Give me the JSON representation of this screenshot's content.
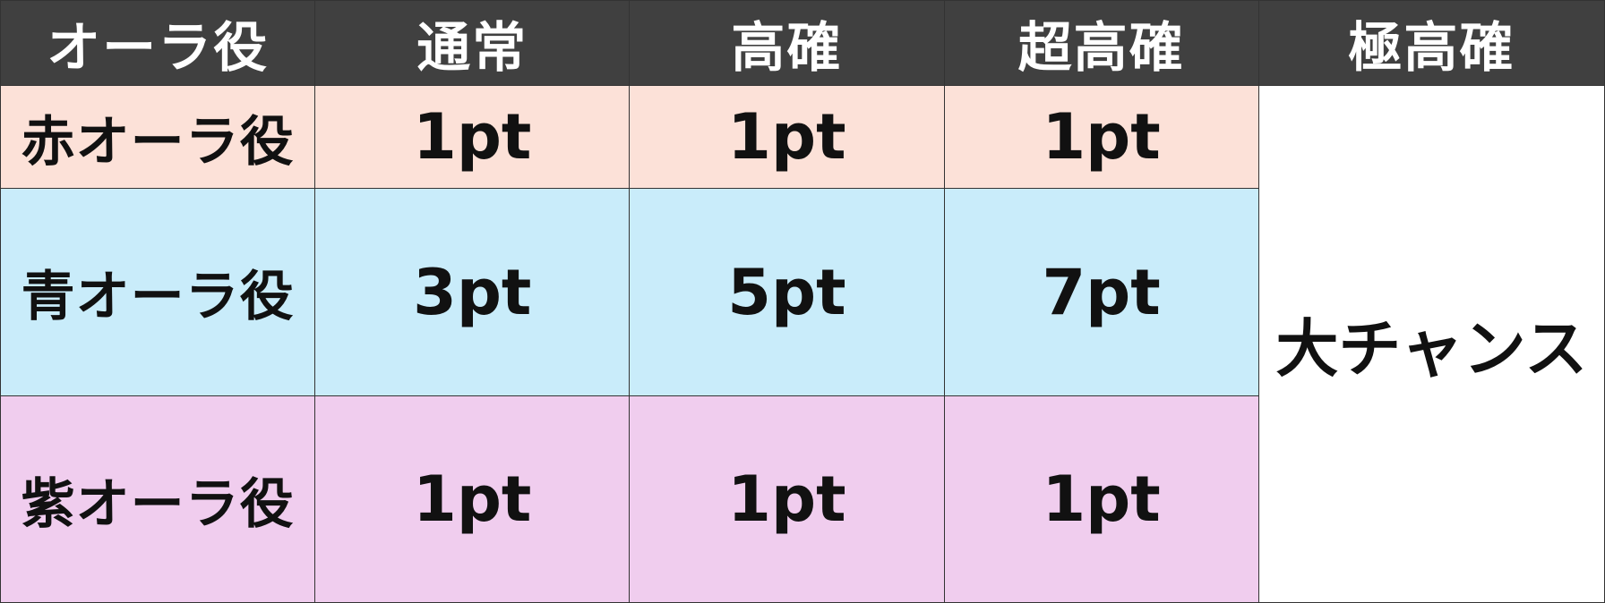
{
  "header": {
    "col_role": "オーラ役",
    "col_normal": "通常",
    "col_high": "高確",
    "col_super_high": "超高確",
    "col_ultra_high": "極高確"
  },
  "rows": [
    {
      "label": "赤オーラ役",
      "normal": "1pt",
      "high": "1pt",
      "super_high": "1pt"
    },
    {
      "label": "青オーラ役",
      "normal": "3pt",
      "high": "5pt",
      "super_high": "7pt"
    },
    {
      "label": "紫オーラ役",
      "normal": "1pt",
      "high": "1pt",
      "super_high": "1pt"
    }
  ],
  "ultra_high_value": "大チャンス",
  "colors": {
    "header_bg": "#404040",
    "red_row_bg": "#fce1d8",
    "blue_row_bg": "#c9ecfa",
    "purple_row_bg": "#f0cdee"
  }
}
